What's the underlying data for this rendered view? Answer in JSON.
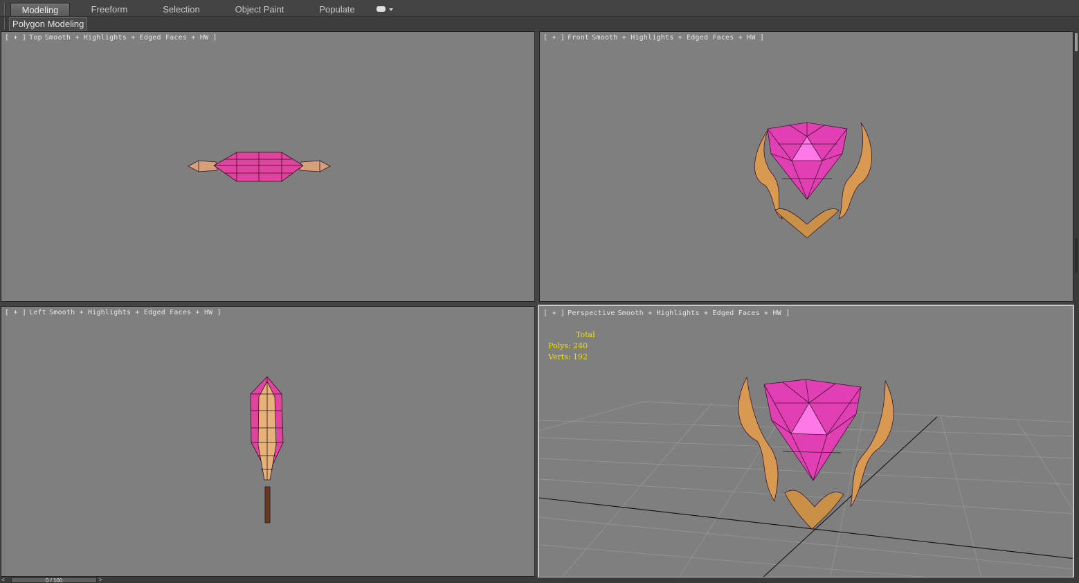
{
  "ribbon": {
    "tabs": [
      {
        "label": "Modeling",
        "active": true
      },
      {
        "label": "Freeform",
        "active": false
      },
      {
        "label": "Selection",
        "active": false
      },
      {
        "label": "Object Paint",
        "active": false
      },
      {
        "label": "Populate",
        "active": false
      }
    ],
    "panel_label": "Polygon Modeling"
  },
  "viewports": {
    "top": {
      "bracket_open": "[ + ]",
      "name": "Top",
      "mode": "Smooth + Highlights + Edged Faces + HW ]"
    },
    "front": {
      "bracket_open": "[ + ]",
      "name": "Front",
      "mode": "Smooth + Highlights + Edged Faces + HW ]"
    },
    "left": {
      "bracket_open": "[ + ]",
      "name": "Left",
      "mode": "Smooth + Highlights + Edged Faces + HW ]"
    },
    "perspective": {
      "bracket_open": "[ + ]",
      "name": "Perspective",
      "mode": "Smooth + Highlights + Edged Faces + HW ]"
    }
  },
  "stats": {
    "header": "Total",
    "polys": "Polys: 240",
    "verts": "Verts: 192"
  },
  "timebar": {
    "prev": "<",
    "frame": "0 / 100",
    "next": ">"
  },
  "colors": {
    "viewport_bg": "#7f7f7f",
    "gem": "#e23fb4",
    "gem_light": "#ff70e0",
    "gold": "#d9a15a",
    "stats_text": "#f0e000",
    "ui_bg": "#444444"
  }
}
